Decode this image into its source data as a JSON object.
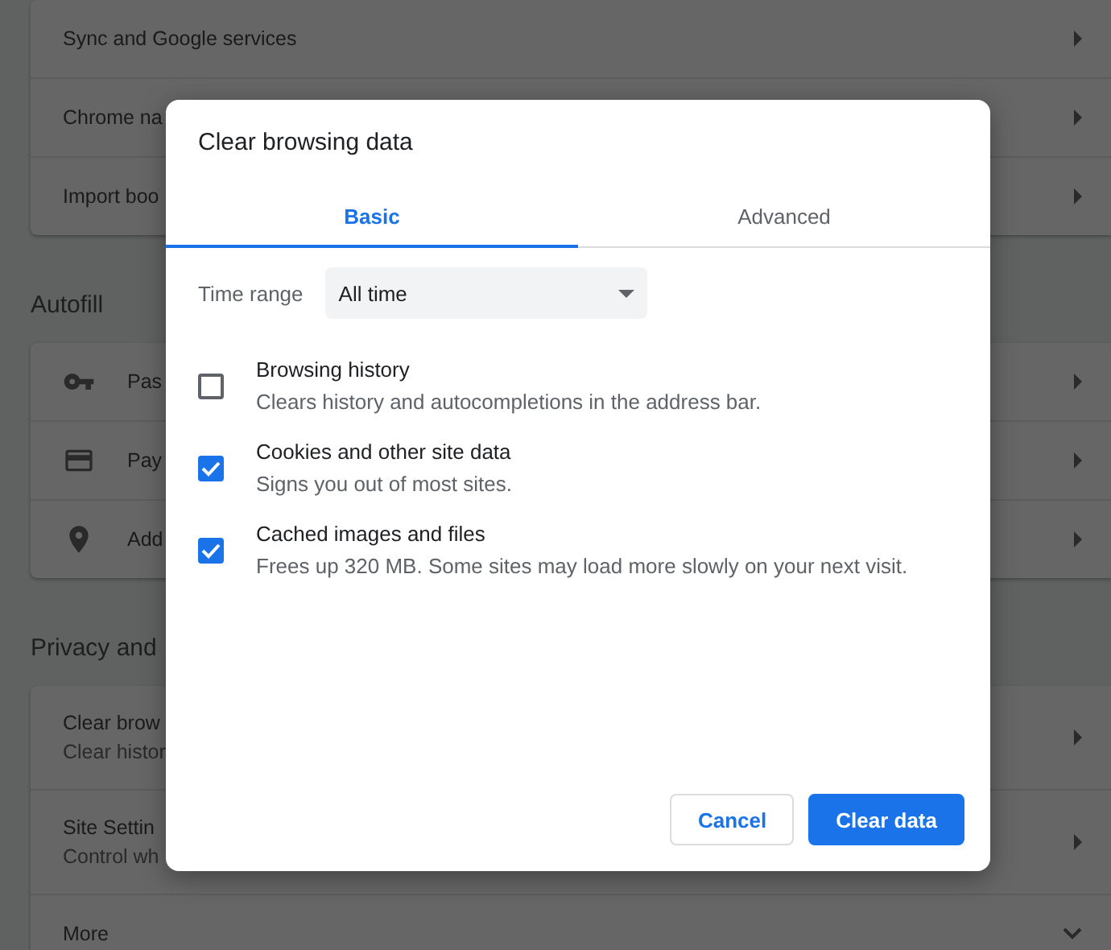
{
  "settings_page": {
    "sections": [
      {
        "rows": [
          {
            "title": "Sync and Google services",
            "kind": "link"
          },
          {
            "title": "Chrome na",
            "kind": "link"
          },
          {
            "title": "Import boo",
            "kind": "link"
          }
        ]
      },
      {
        "heading": "Autofill",
        "rows": [
          {
            "title": "Pas",
            "kind": "icon_link"
          },
          {
            "title": "Pay",
            "kind": "icon_link"
          },
          {
            "title": "Add",
            "kind": "icon_link"
          }
        ]
      },
      {
        "heading": "Privacy and",
        "rows": [
          {
            "title": "Clear brow",
            "subtitle": "Clear histor",
            "kind": "link"
          },
          {
            "title": "Site Settin",
            "subtitle": "Control wh",
            "kind": "link"
          },
          {
            "title": "More",
            "kind": "expand"
          }
        ]
      }
    ]
  },
  "dialog": {
    "title": "Clear browsing data",
    "tabs": [
      {
        "label": "Basic",
        "selected": true
      },
      {
        "label": "Advanced",
        "selected": false
      }
    ],
    "time_range": {
      "label": "Time range",
      "value": "All time"
    },
    "options": [
      {
        "title": "Browsing history",
        "description": "Clears history and autocompletions in the address bar.",
        "checked": false
      },
      {
        "title": "Cookies and other site data",
        "description": "Signs you out of most sites.",
        "checked": true
      },
      {
        "title": "Cached images and files",
        "description": "Frees up 320 MB. Some sites may load more slowly on your next visit.",
        "checked": true
      }
    ],
    "buttons": [
      {
        "label": "Cancel",
        "kind": "secondary"
      },
      {
        "label": "Clear data",
        "kind": "primary"
      }
    ]
  }
}
